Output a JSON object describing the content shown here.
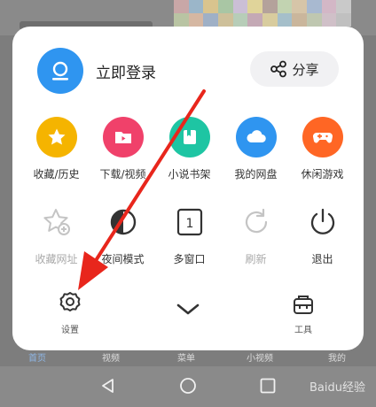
{
  "header": {
    "login_label": "立即登录",
    "share_label": "分享"
  },
  "row1": [
    {
      "label": "收藏/历史",
      "color": "#f5b400"
    },
    {
      "label": "下载/视频",
      "color": "#f0416a"
    },
    {
      "label": "小说书架",
      "color": "#1ec5a3"
    },
    {
      "label": "我的网盘",
      "color": "#2f95f0"
    },
    {
      "label": "休闲游戏",
      "color": "#ff6624"
    }
  ],
  "row2": [
    {
      "label": "收藏网址"
    },
    {
      "label": "夜间模式"
    },
    {
      "label": "多窗口",
      "badge": "1"
    },
    {
      "label": "刷新"
    },
    {
      "label": "退出"
    }
  ],
  "bottom": {
    "settings_label": "设置",
    "tools_label": "工具"
  },
  "tabbar": [
    "首页",
    "视频",
    "菜单",
    "小视频",
    "我的"
  ],
  "watermark": "Baidu经验",
  "colors": {
    "accent": "#2f95f0",
    "arrow": "#e8261c"
  }
}
